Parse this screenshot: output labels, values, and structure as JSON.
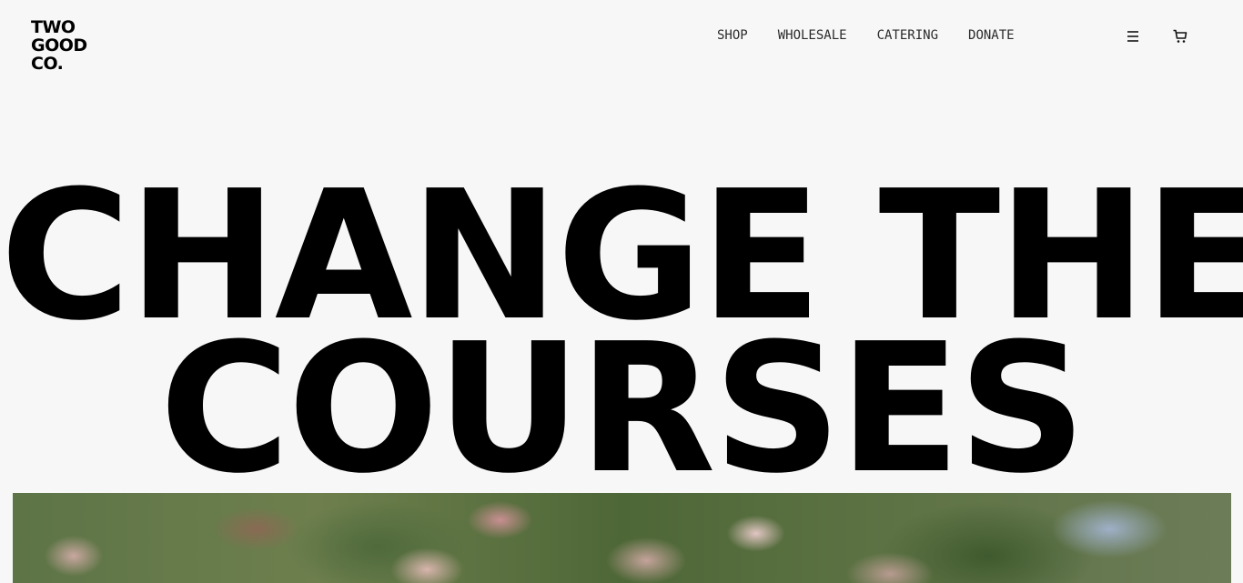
{
  "brand": {
    "logo_lines": [
      "TWO",
      "GOOD",
      "CO."
    ]
  },
  "nav": {
    "items": [
      {
        "label": "SHOP"
      },
      {
        "label": "WHOLESALE"
      },
      {
        "label": "CATERING"
      },
      {
        "label": "DONATE"
      }
    ]
  },
  "icons": {
    "menu": "menu-icon",
    "cart": "cart-icon"
  },
  "hero": {
    "title_lines": [
      "CHANGE THE",
      "COURSES"
    ],
    "media_alt": "flowering shrub foliage"
  }
}
